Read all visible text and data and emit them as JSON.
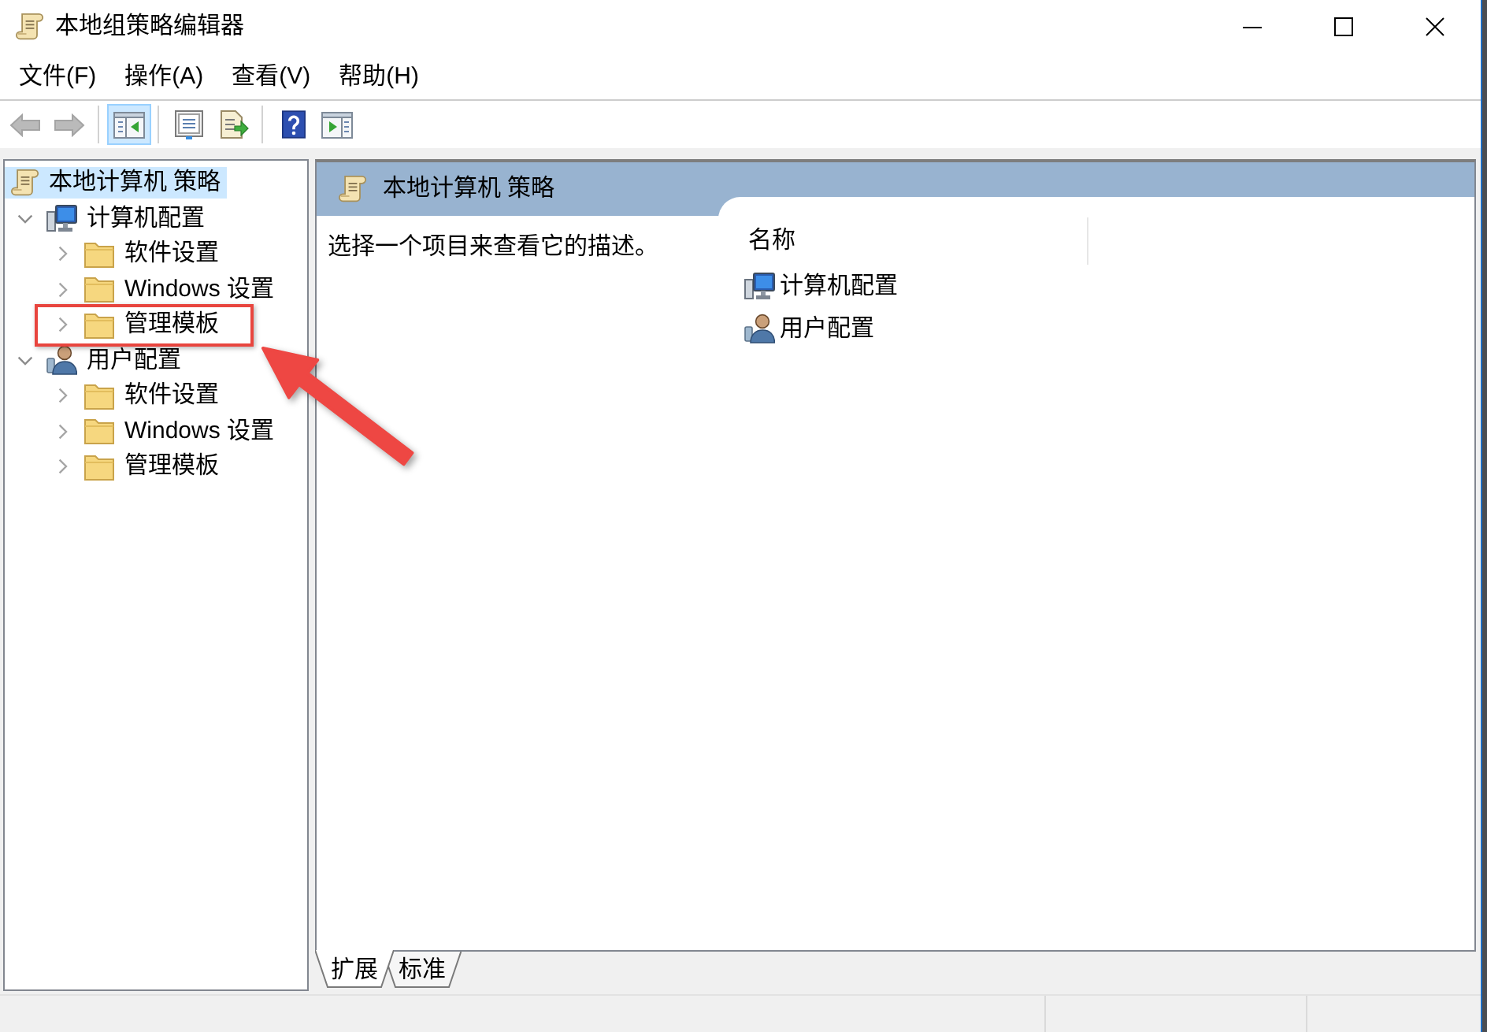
{
  "window": {
    "title": "本地组策略编辑器"
  },
  "menu": [
    "文件(F)",
    "操作(A)",
    "查看(V)",
    "帮助(H)"
  ],
  "toolbar": {
    "groups": [
      {
        "buttons": [
          {
            "kind": "back",
            "disabled": true,
            "pressed": false
          },
          {
            "kind": "forward",
            "disabled": true,
            "pressed": false
          }
        ]
      },
      {
        "buttons": [
          {
            "kind": "show-tree",
            "disabled": false,
            "pressed": true
          }
        ]
      },
      {
        "buttons": [
          {
            "kind": "properties",
            "disabled": false,
            "pressed": false
          },
          {
            "kind": "export",
            "disabled": false,
            "pressed": false
          }
        ]
      },
      {
        "buttons": [
          {
            "kind": "help",
            "disabled": false,
            "pressed": false
          },
          {
            "kind": "show-action-pane",
            "disabled": false,
            "pressed": false
          }
        ]
      }
    ]
  },
  "tree": [
    {
      "kind": "policy",
      "label": "本地计算机 策略",
      "selected": true,
      "children": [
        {
          "kind": "computer",
          "label": "计算机配置",
          "expanded": true,
          "selected": false,
          "children": [
            {
              "kind": "folder",
              "label": "软件设置",
              "expanded": false,
              "selected": false,
              "callout": false
            },
            {
              "kind": "folder",
              "label": "Windows 设置",
              "expanded": false,
              "selected": false,
              "callout": false
            },
            {
              "kind": "folder",
              "label": "管理模板",
              "expanded": false,
              "selected": false,
              "callout": true
            }
          ]
        },
        {
          "kind": "user",
          "label": "用户配置",
          "expanded": true,
          "selected": false,
          "children": [
            {
              "kind": "folder",
              "label": "软件设置",
              "expanded": false,
              "selected": false,
              "callout": false
            },
            {
              "kind": "folder",
              "label": "Windows 设置",
              "expanded": false,
              "selected": false,
              "callout": false
            },
            {
              "kind": "folder",
              "label": "管理模板",
              "expanded": false,
              "selected": false,
              "callout": false
            }
          ]
        }
      ]
    }
  ],
  "details": {
    "header": {
      "kind": "policy",
      "title": "本地计算机 策略"
    },
    "description": "选择一个项目来查看它的描述。",
    "columns": [
      "名称"
    ],
    "items": [
      {
        "kind": "computer",
        "label": "计算机配置",
        "selected": false
      },
      {
        "kind": "user",
        "label": "用户配置",
        "selected": false
      }
    ]
  },
  "view_tabs": [
    {
      "label": "扩展",
      "selected": true
    },
    {
      "label": "标准",
      "selected": false
    }
  ]
}
